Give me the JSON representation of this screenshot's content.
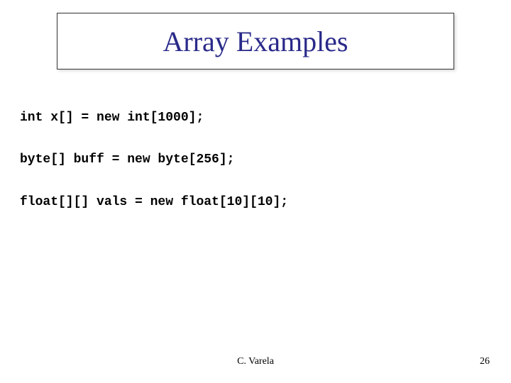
{
  "title": "Array Examples",
  "code": {
    "line1": "int x[] = new int[1000];",
    "line2": "byte[] buff = new byte[256];",
    "line3": "float[][] vals = new float[10][10];"
  },
  "footer": {
    "author": "C. Varela",
    "page": "26"
  }
}
